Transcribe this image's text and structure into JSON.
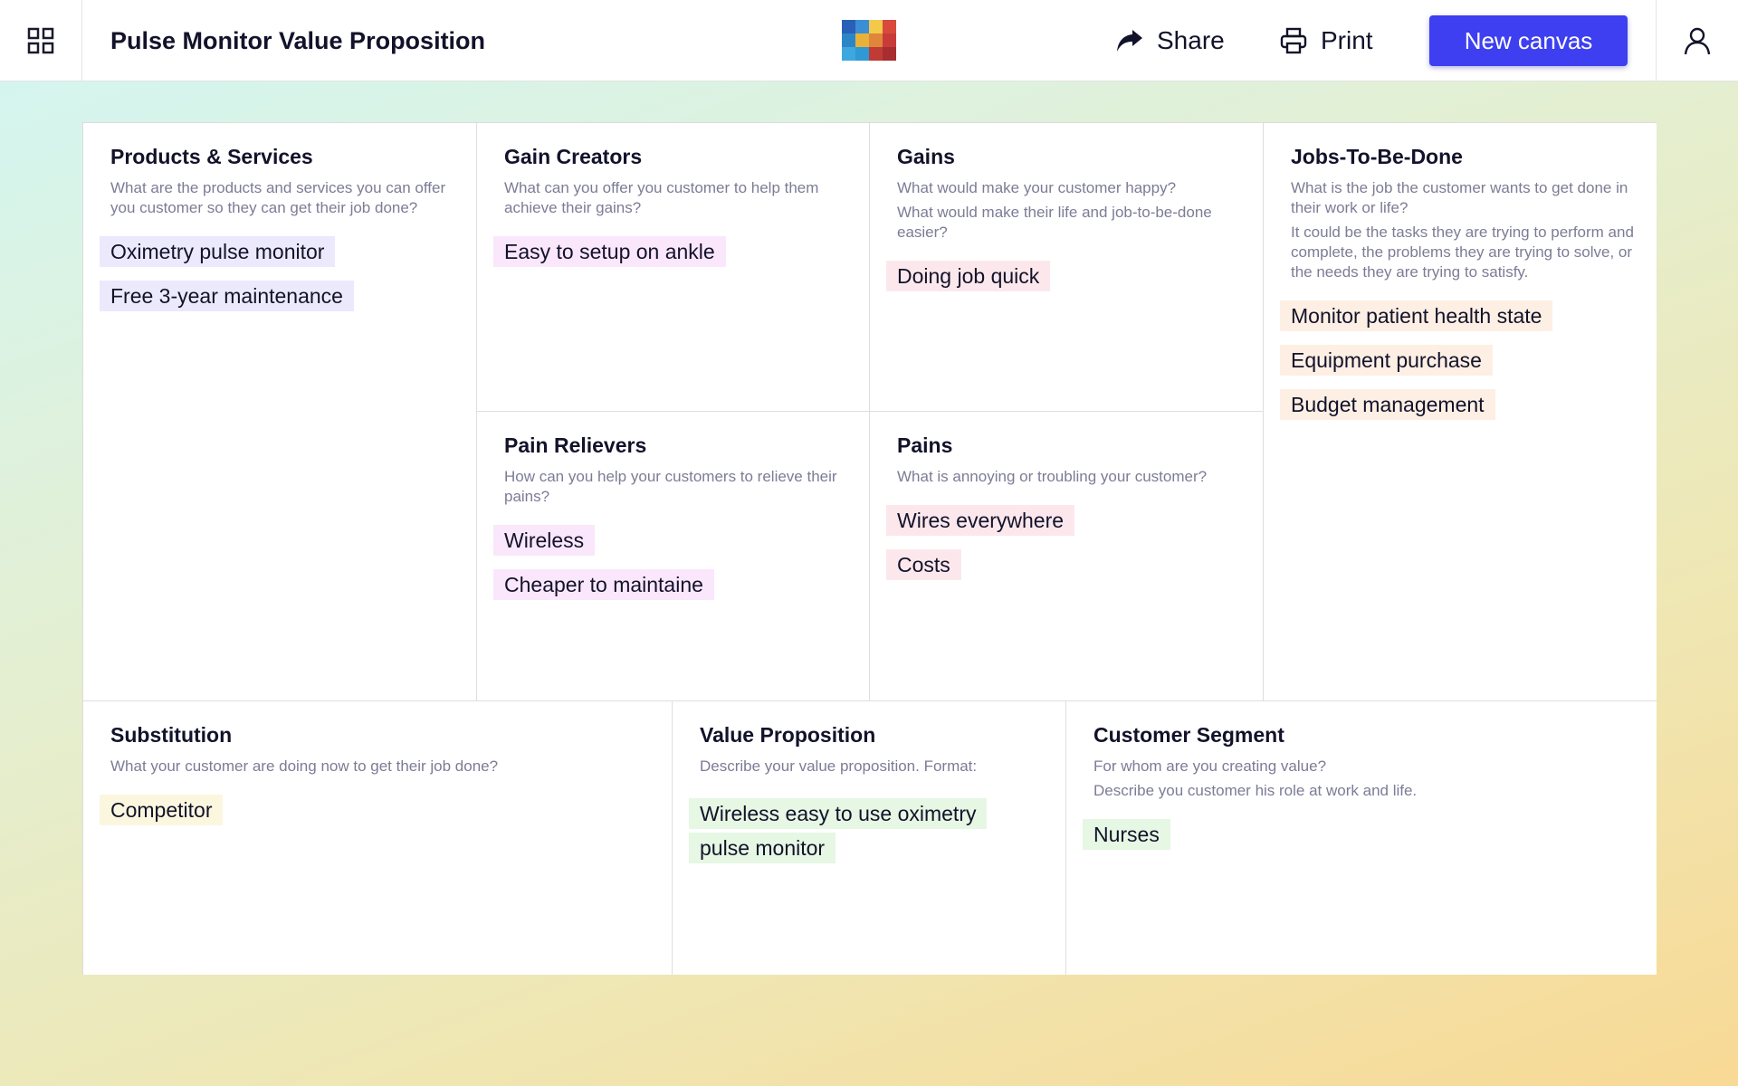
{
  "header": {
    "title": "Pulse Monitor Value Proposition",
    "share_label": "Share",
    "print_label": "Print",
    "new_canvas_label": "New canvas"
  },
  "colors": {
    "accent": "#3d3ff0",
    "note_purple": "#ece9fc",
    "note_pink": "#fae7fb",
    "note_rose": "#fce8ec",
    "note_peach": "#fdefe4",
    "note_yellow": "#fbf7df",
    "note_green": "#e6f7e4"
  },
  "icons": [
    "grid-menu-icon",
    "app-logo-icon",
    "share-icon",
    "printer-icon",
    "user-icon"
  ],
  "canvas": {
    "products": {
      "title": "Products & Services",
      "desc": [
        "What are the products and services you can offer you customer so they can get their job done?"
      ],
      "notes": [
        "Oximetry pulse monitor",
        "Free 3-year maintenance"
      ]
    },
    "gain_creators": {
      "title": "Gain Creators",
      "desc": [
        "What can you offer you customer to help them achieve their gains?"
      ],
      "notes": [
        "Easy to setup on ankle"
      ]
    },
    "gains": {
      "title": "Gains",
      "desc": [
        "What would make your customer happy?",
        "What would make their life and job-to-be-done easier?"
      ],
      "notes": [
        "Doing job quick"
      ]
    },
    "jobs": {
      "title": "Jobs-To-Be-Done",
      "desc": [
        "What is the job the customer wants to get done in their work or life?",
        "It could be the tasks they are trying to perform and complete, the problems they are trying to solve, or the needs they are trying to satisfy."
      ],
      "notes": [
        "Monitor patient health state",
        "Equipment purchase",
        "Budget management"
      ]
    },
    "pain_relievers": {
      "title": "Pain Relievers",
      "desc": [
        "How can you help your customers to relieve their pains?"
      ],
      "notes": [
        "Wireless",
        "Cheaper to maintaine"
      ]
    },
    "pains": {
      "title": "Pains",
      "desc": [
        "What is annoying or troubling your customer?"
      ],
      "notes": [
        "Wires everywhere",
        "Costs"
      ]
    },
    "substitution": {
      "title": "Substitution",
      "desc": [
        "What your customer are doing now to get their job done?"
      ],
      "notes": [
        "Competitor"
      ]
    },
    "value_proposition": {
      "title": "Value Proposition",
      "desc": [
        "Describe your value proposition. Format:"
      ],
      "notes": [
        "Wireless easy to use oximetry pulse monitor"
      ]
    },
    "customer_segment": {
      "title": "Customer Segment",
      "desc": [
        "For whom are you creating value?",
        "Describe you customer his role at work and life."
      ],
      "notes": [
        "Nurses"
      ]
    }
  }
}
